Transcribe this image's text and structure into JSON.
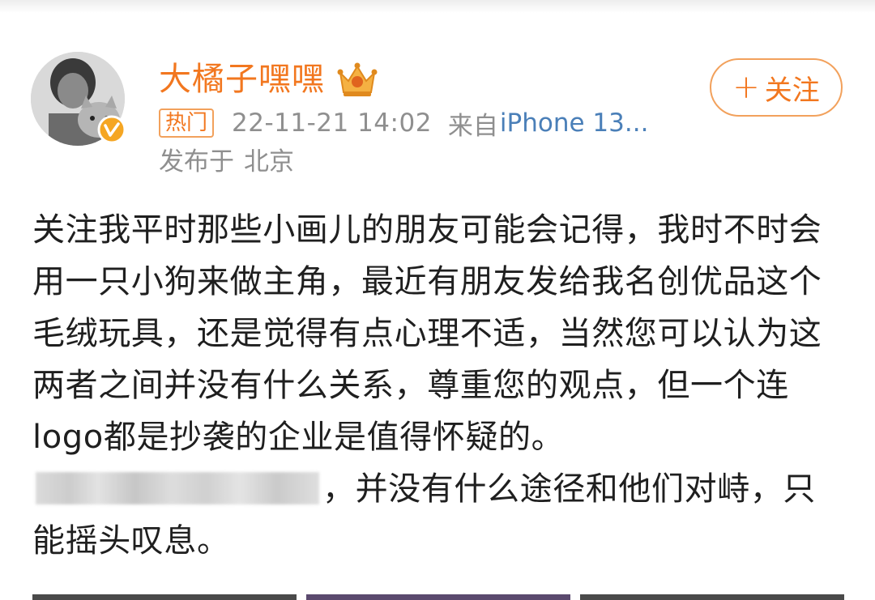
{
  "post": {
    "author": {
      "name": "大橘子嘿嘿",
      "avatar_icon": "user-avatar-with-cat",
      "verified_icon": "verified-v-badge",
      "crown_icon": "vip-crown-icon"
    },
    "follow_button": {
      "icon": "plus-icon",
      "plus": "+",
      "label": "关注"
    },
    "hot_badge": "热门",
    "timestamp": "22-11-21 14:02",
    "source_label": "来自",
    "source_device": "iPhone 13...",
    "location_label": "发布于",
    "location_city": "北京",
    "content": {
      "part1": "关注我平时那些小画儿的朋友可能会记得，我时不时会用一只小狗来做主角，最近有朋友发给我名创优品这个毛绒玩具，还是觉得有点心理不适，当然您可以认为这两者之间并没有什么关系，尊重您的观点，但一个连logo都是抄袭的企业是值得怀疑的。",
      "part2": "，并没有什么途径和他们对峙，只能摇头叹息。"
    }
  },
  "colors": {
    "accent": "#f2771f",
    "meta_gray": "#8f8f8f",
    "device_blue": "#4a7fb8",
    "text": "#1f1f1f"
  }
}
